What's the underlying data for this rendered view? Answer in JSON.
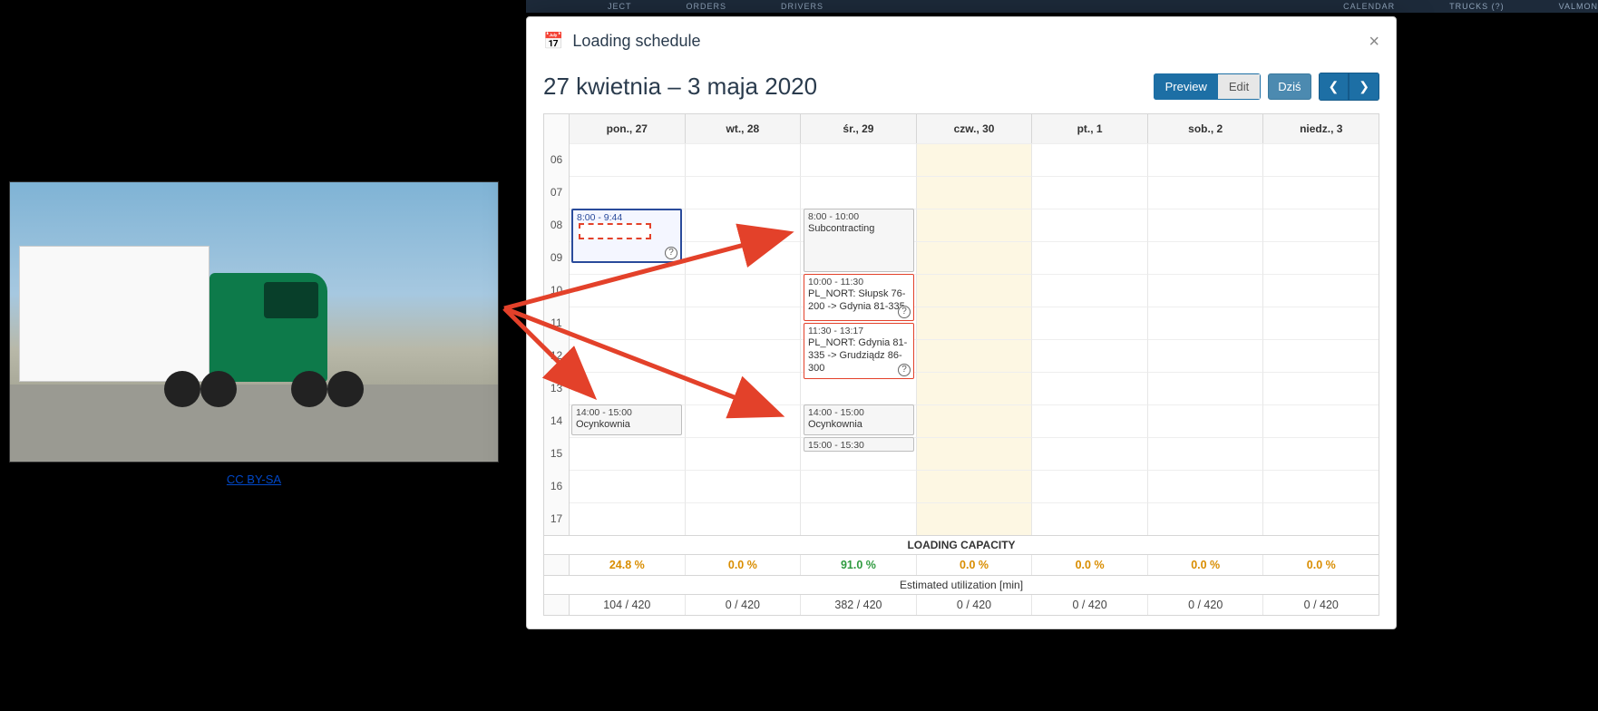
{
  "bg_nav": [
    "JECT",
    "ORDERS",
    "DRIVERS",
    "CALENDAR",
    "TRUCKS (?)",
    "VALMON"
  ],
  "credit_label": "CC BY-SA",
  "modal": {
    "title": "Loading schedule",
    "date_range": "27 kwietnia – 3 maja 2020",
    "buttons": {
      "preview": "Preview",
      "edit": "Edit",
      "today": "Dziś"
    }
  },
  "days": [
    {
      "label": "pon., 27"
    },
    {
      "label": "wt., 28"
    },
    {
      "label": "śr., 29"
    },
    {
      "label": "czw., 30"
    },
    {
      "label": "pt., 1"
    },
    {
      "label": "sob., 2"
    },
    {
      "label": "niedz., 3"
    }
  ],
  "hours": [
    "06",
    "07",
    "08",
    "09",
    "10",
    "11",
    "12",
    "13",
    "14",
    "15",
    "16",
    "17"
  ],
  "highlight_day_index": 3,
  "events": [
    {
      "day": 0,
      "start": 8,
      "end": 9.73,
      "time": "8:00 - 9:44",
      "text": "",
      "style": "blue",
      "dashed": true,
      "q": true
    },
    {
      "day": 0,
      "start": 14,
      "end": 15,
      "time": "14:00 - 15:00",
      "text": "Ocynkownia",
      "style": "grey"
    },
    {
      "day": 2,
      "start": 8,
      "end": 10,
      "time": "8:00 - 10:00",
      "text": "Subcontracting",
      "style": "grey"
    },
    {
      "day": 2,
      "start": 10,
      "end": 11.5,
      "time": "10:00 - 11:30",
      "text": "PL_NORT: Słupsk 76-200 -> Gdynia 81-335",
      "style": "red",
      "q": true
    },
    {
      "day": 2,
      "start": 11.5,
      "end": 13.28,
      "time": "11:30 - 13:17",
      "text": "PL_NORT: Gdynia 81-335 -> Grudziądz 86-300",
      "style": "red",
      "q": true
    },
    {
      "day": 2,
      "start": 14,
      "end": 15,
      "time": "14:00 - 15:00",
      "text": "Ocynkownia",
      "style": "grey"
    },
    {
      "day": 2,
      "start": 15,
      "end": 15.5,
      "time": "15:00 - 15:30",
      "text": "",
      "style": "grey"
    }
  ],
  "footer": {
    "capacity_title": "LOADING CAPACITY",
    "utilization_title": "Estimated utilization [min]",
    "pct": [
      "24.8 %",
      "0.0 %",
      "91.0 %",
      "0.0 %",
      "0.0 %",
      "0.0 %",
      "0.0 %"
    ],
    "pct_green_idx": 2,
    "util": [
      "104 / 420",
      "0 / 420",
      "382 / 420",
      "0 / 420",
      "0 / 420",
      "0 / 420",
      "0 / 420"
    ]
  }
}
